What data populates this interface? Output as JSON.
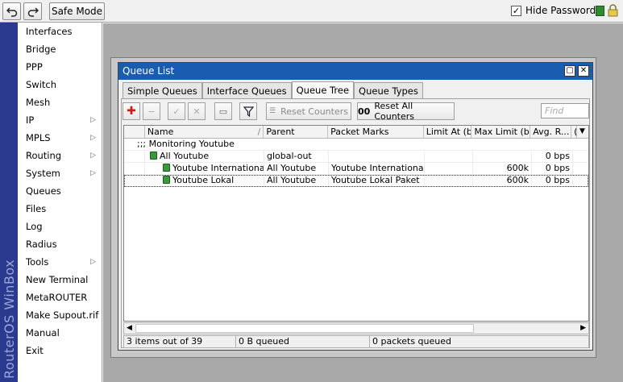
{
  "toolbar": {
    "undo_icon": "undo-icon",
    "redo_icon": "redo-icon",
    "safe_mode_label": "Safe Mode",
    "hide_passwords_label": "Hide Passwords",
    "hide_passwords_checked": true,
    "check_mark": "✓"
  },
  "brand": {
    "text": "RouterOS WinBox"
  },
  "sidebar": {
    "items": [
      {
        "label": "Interfaces",
        "submenu": false
      },
      {
        "label": "Bridge",
        "submenu": false
      },
      {
        "label": "PPP",
        "submenu": false
      },
      {
        "label": "Switch",
        "submenu": false
      },
      {
        "label": "Mesh",
        "submenu": false
      },
      {
        "label": "IP",
        "submenu": true
      },
      {
        "label": "MPLS",
        "submenu": true
      },
      {
        "label": "Routing",
        "submenu": true
      },
      {
        "label": "System",
        "submenu": true
      },
      {
        "label": "Queues",
        "submenu": false
      },
      {
        "label": "Files",
        "submenu": false
      },
      {
        "label": "Log",
        "submenu": false
      },
      {
        "label": "Radius",
        "submenu": false
      },
      {
        "label": "Tools",
        "submenu": true
      },
      {
        "label": "New Terminal",
        "submenu": false
      },
      {
        "label": "MetaROUTER",
        "submenu": false
      },
      {
        "label": "Make Supout.rif",
        "submenu": false
      },
      {
        "label": "Manual",
        "submenu": false
      },
      {
        "label": "Exit",
        "submenu": false
      }
    ],
    "submenu_arrow": "▷"
  },
  "window": {
    "title": "Queue List",
    "restore_glyph": "▢",
    "close_glyph": "✕",
    "tabs": [
      {
        "label": "Simple Queues",
        "active": false
      },
      {
        "label": "Interface Queues",
        "active": false
      },
      {
        "label": "Queue Tree",
        "active": true
      },
      {
        "label": "Queue Types",
        "active": false
      }
    ],
    "actions": {
      "add_glyph": "✚",
      "remove_glyph": "−",
      "enable_glyph": "✓",
      "disable_glyph": "✕",
      "comment_glyph": "▭",
      "filter_glyph": "▼",
      "reset_counters_label": "Reset Counters",
      "reset_all_counters_prefix": "00",
      "reset_all_counters_label": "Reset All Counters",
      "find_placeholder": "Find"
    },
    "columns": [
      "Name",
      "Parent",
      "Packet Marks",
      "Limit At (b...",
      "Max Limit (bi...",
      "Avg. R...",
      "("
    ],
    "sort_glyph": "/",
    "rows": [
      {
        "type": "comment",
        "name": ";;; Monitoring Youtube"
      },
      {
        "type": "queue",
        "level": 1,
        "name": "All Youtube",
        "parent": "global-out",
        "marks": "",
        "limit_at": "",
        "max_limit": "",
        "avg_rate": "0 bps"
      },
      {
        "type": "queue",
        "level": 2,
        "name": "Youtube International",
        "parent": "All Youtube",
        "marks": "Youtube International ...",
        "limit_at": "",
        "max_limit": "600k",
        "avg_rate": "0 bps"
      },
      {
        "type": "queue",
        "level": 2,
        "name": "Youtube Lokal",
        "parent": "All Youtube",
        "marks": "Youtube Lokal Paket",
        "limit_at": "",
        "max_limit": "600k",
        "avg_rate": "0 bps"
      }
    ],
    "status": {
      "items": "3 items out of 39",
      "queued_bytes": "0 B queued",
      "queued_packets": "0 packets queued"
    }
  }
}
